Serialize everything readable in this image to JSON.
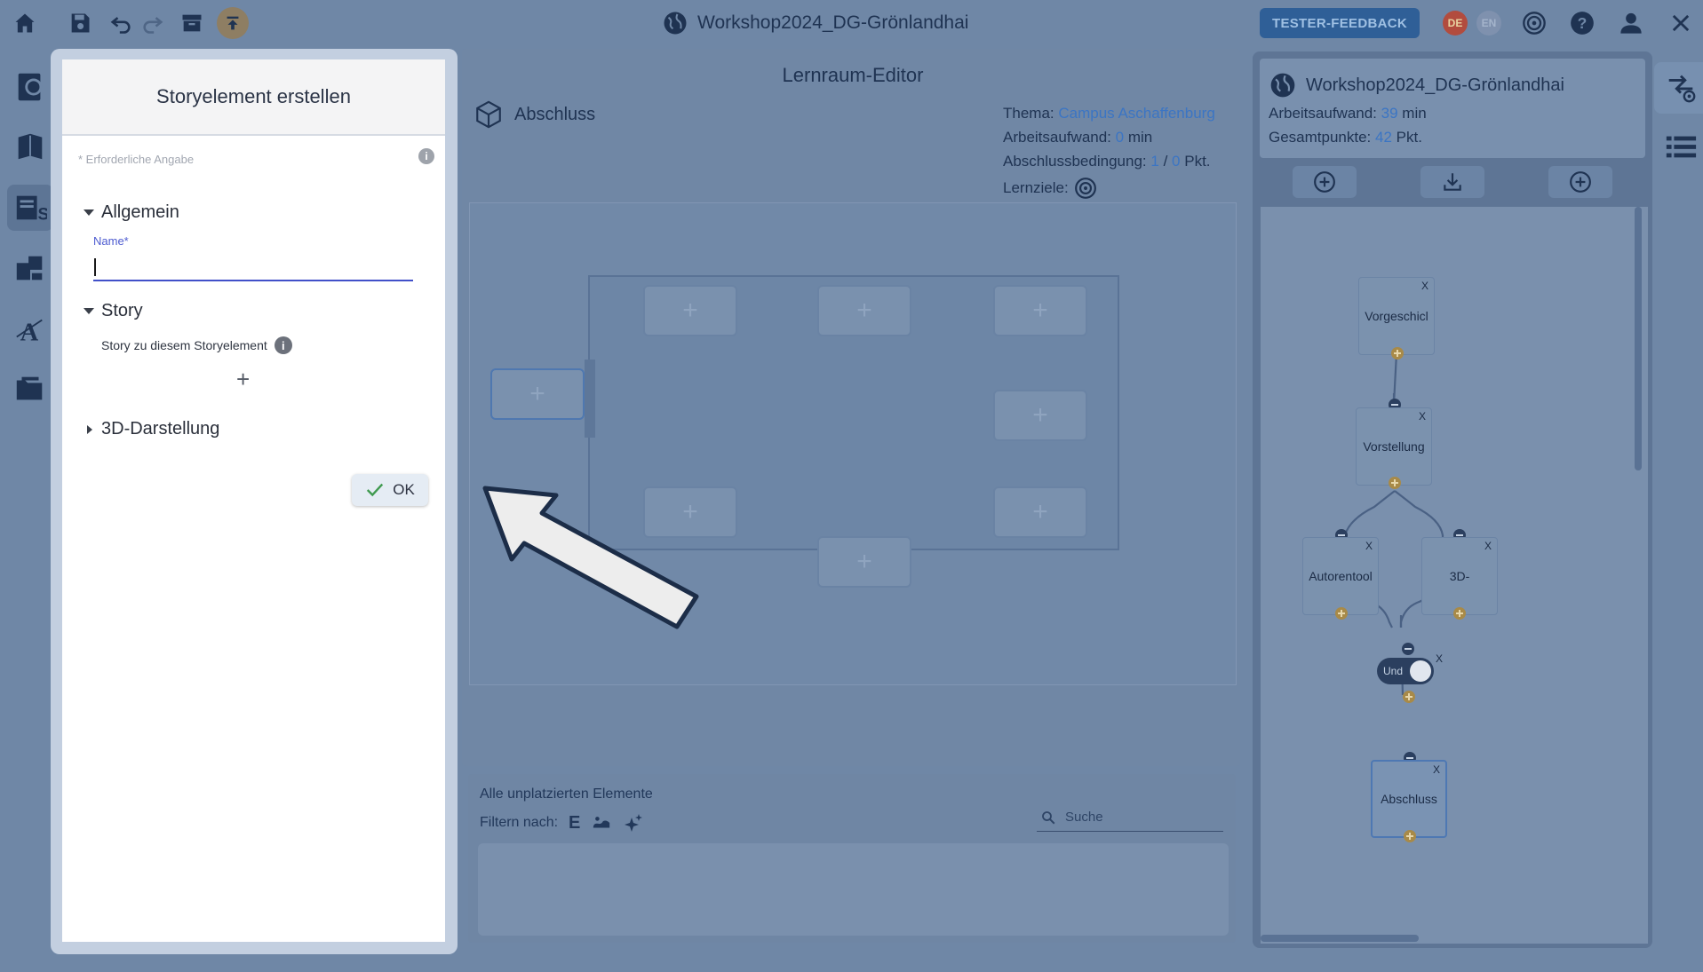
{
  "app": {
    "title": "Workshop2024_DG-Grönlandhai",
    "tester_feedback": "TESTER-FEEDBACK",
    "lang_de": "DE",
    "lang_en": "EN"
  },
  "dialog": {
    "title": "Storyelement erstellen",
    "required_note": "* Erforderliche Angabe",
    "section_general": "Allgemein",
    "name_label": "Name*",
    "name_value": "",
    "section_story": "Story",
    "story_hint": "Story zu diesem Storyelement",
    "add_symbol": "+",
    "section_3d": "3D-Darstellung",
    "ok_label": "OK"
  },
  "editor": {
    "title": "Lernraum-Editor",
    "space_name": "Abschluss",
    "theme_label": "Thema:",
    "theme_value": "Campus Aschaffenburg",
    "workload_label": "Arbeitsaufwand:",
    "workload_value": "0",
    "workload_unit": "min",
    "completion_label": "Abschlussbedingung:",
    "completion_a": "1",
    "completion_sep": "/",
    "completion_b": "0",
    "completion_unit": "Pkt.",
    "goals_label": "Lernziele:",
    "slot_symbol": "+"
  },
  "unplaced": {
    "title": "Alle unplatzierten Elemente",
    "filter_label": "Filtern nach:",
    "filter_letter": "E",
    "search_placeholder": "Suche"
  },
  "world": {
    "title": "Workshop2024_DG-Grönlandhai",
    "workload_label": "Arbeitsaufwand:",
    "workload_value": "39",
    "workload_unit": "min",
    "points_label": "Gesamtpunkte:",
    "points_value": "42",
    "points_unit": "Pkt."
  },
  "graph": {
    "nodes": [
      "Vorgeschicl",
      "Vorstellung",
      "Autorentool",
      "3D-",
      "Abschluss"
    ],
    "close_symbol": "X",
    "condition_label": "Und"
  },
  "colors": {
    "overlay_blue": "#6f87a6",
    "accent": "#3b75c4",
    "input_focus": "#4150c9"
  }
}
